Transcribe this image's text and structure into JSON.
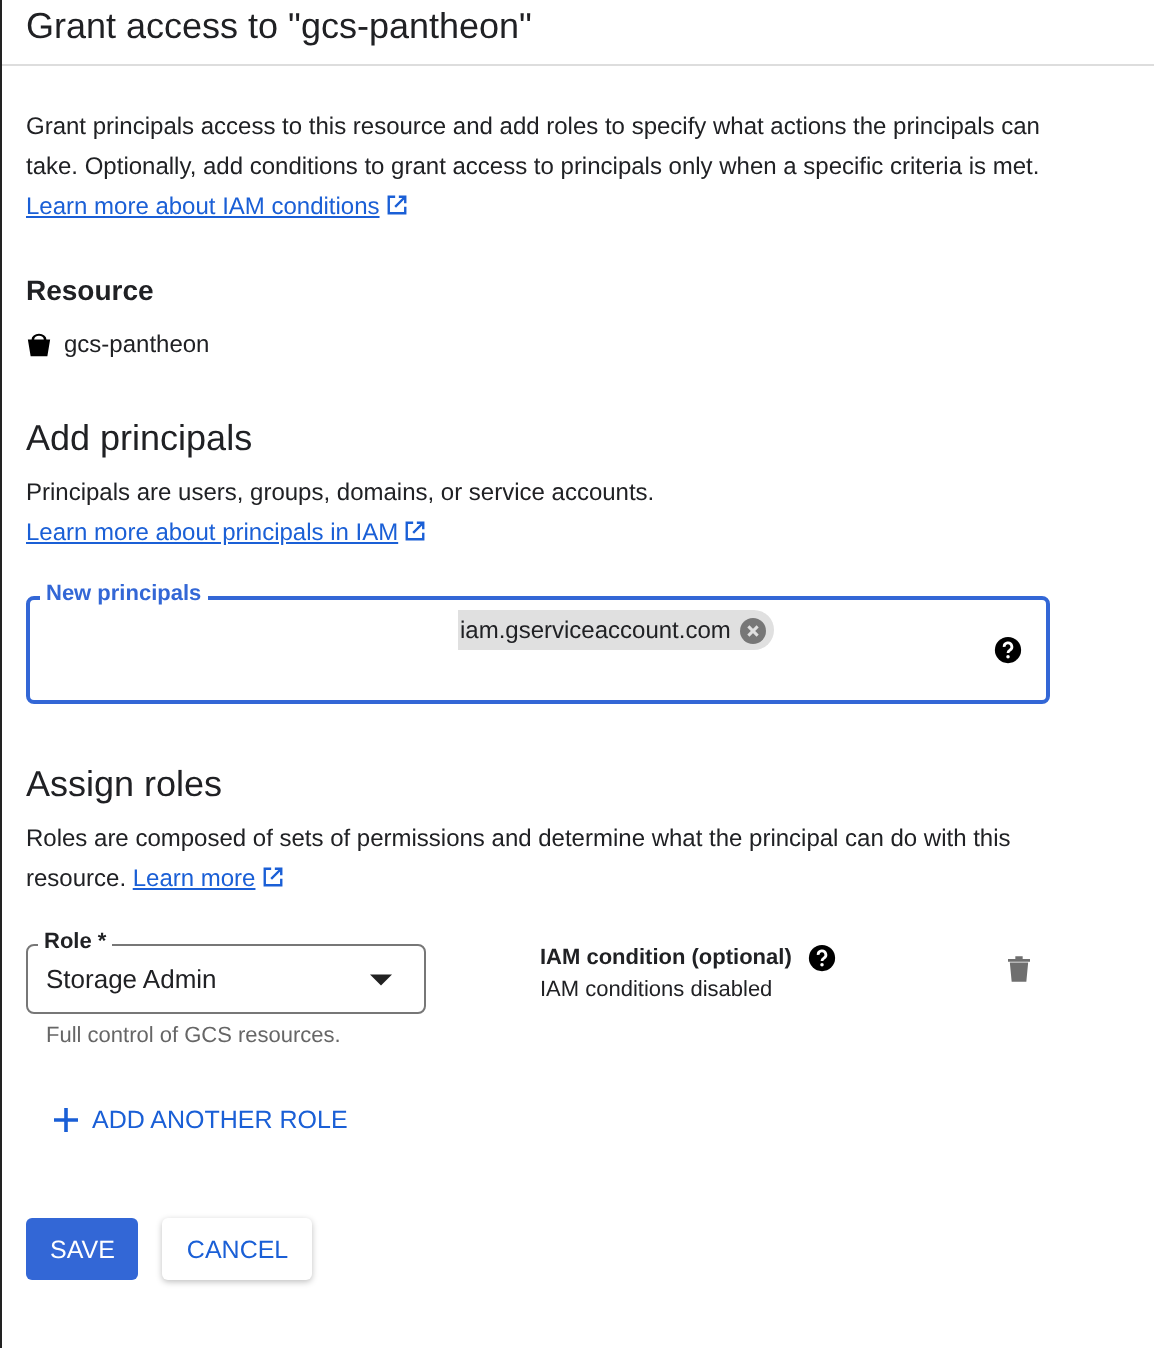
{
  "title": "Grant access to \"gcs-pantheon\"",
  "intro": {
    "text": "Grant principals access to this resource and add roles to specify what actions the principals can take. Optionally, add conditions to grant access to principals only when a specific criteria is met.",
    "link": "Learn more about IAM conditions"
  },
  "resource": {
    "heading": "Resource",
    "name": "gcs-pantheon"
  },
  "principals": {
    "heading": "Add principals",
    "text": "Principals are users, groups, domains, or service accounts.",
    "link": "Learn more about principals in IAM",
    "field": {
      "label": "New principals",
      "focused": true,
      "chips": [
        {
          "text": "iam.gserviceaccount.com"
        }
      ]
    }
  },
  "roles": {
    "heading": "Assign roles",
    "text": "Roles are composed of sets of permissions and determine what the principal can do with this resource.",
    "link": "Learn more",
    "rows": [
      {
        "role_label": "Role *",
        "value": "Storage Admin",
        "helper": "Full control of GCS resources.",
        "condition_label": "IAM condition (optional)",
        "condition_text": "IAM conditions disabled"
      }
    ],
    "add_button": "ADD ANOTHER ROLE"
  },
  "buttons": [
    {
      "label": "SAVE",
      "kind": "primary"
    },
    {
      "label": "CANCEL",
      "kind": "secondary"
    }
  ]
}
